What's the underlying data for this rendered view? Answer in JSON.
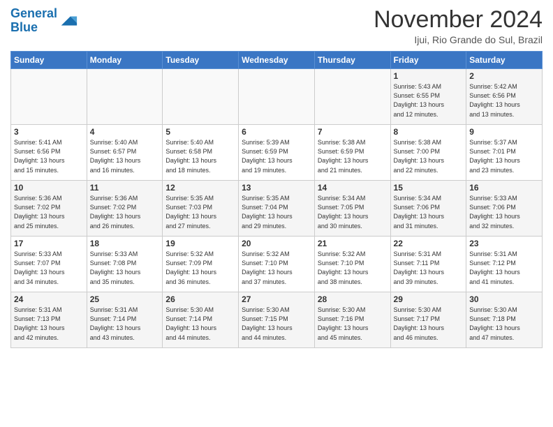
{
  "header": {
    "logo_line1": "General",
    "logo_line2": "Blue",
    "month_year": "November 2024",
    "location": "Ijui, Rio Grande do Sul, Brazil"
  },
  "weekdays": [
    "Sunday",
    "Monday",
    "Tuesday",
    "Wednesday",
    "Thursday",
    "Friday",
    "Saturday"
  ],
  "weeks": [
    [
      {
        "day": "",
        "info": ""
      },
      {
        "day": "",
        "info": ""
      },
      {
        "day": "",
        "info": ""
      },
      {
        "day": "",
        "info": ""
      },
      {
        "day": "",
        "info": ""
      },
      {
        "day": "1",
        "info": "Sunrise: 5:43 AM\nSunset: 6:55 PM\nDaylight: 13 hours\nand 12 minutes."
      },
      {
        "day": "2",
        "info": "Sunrise: 5:42 AM\nSunset: 6:56 PM\nDaylight: 13 hours\nand 13 minutes."
      }
    ],
    [
      {
        "day": "3",
        "info": "Sunrise: 5:41 AM\nSunset: 6:56 PM\nDaylight: 13 hours\nand 15 minutes."
      },
      {
        "day": "4",
        "info": "Sunrise: 5:40 AM\nSunset: 6:57 PM\nDaylight: 13 hours\nand 16 minutes."
      },
      {
        "day": "5",
        "info": "Sunrise: 5:40 AM\nSunset: 6:58 PM\nDaylight: 13 hours\nand 18 minutes."
      },
      {
        "day": "6",
        "info": "Sunrise: 5:39 AM\nSunset: 6:59 PM\nDaylight: 13 hours\nand 19 minutes."
      },
      {
        "day": "7",
        "info": "Sunrise: 5:38 AM\nSunset: 6:59 PM\nDaylight: 13 hours\nand 21 minutes."
      },
      {
        "day": "8",
        "info": "Sunrise: 5:38 AM\nSunset: 7:00 PM\nDaylight: 13 hours\nand 22 minutes."
      },
      {
        "day": "9",
        "info": "Sunrise: 5:37 AM\nSunset: 7:01 PM\nDaylight: 13 hours\nand 23 minutes."
      }
    ],
    [
      {
        "day": "10",
        "info": "Sunrise: 5:36 AM\nSunset: 7:02 PM\nDaylight: 13 hours\nand 25 minutes."
      },
      {
        "day": "11",
        "info": "Sunrise: 5:36 AM\nSunset: 7:02 PM\nDaylight: 13 hours\nand 26 minutes."
      },
      {
        "day": "12",
        "info": "Sunrise: 5:35 AM\nSunset: 7:03 PM\nDaylight: 13 hours\nand 27 minutes."
      },
      {
        "day": "13",
        "info": "Sunrise: 5:35 AM\nSunset: 7:04 PM\nDaylight: 13 hours\nand 29 minutes."
      },
      {
        "day": "14",
        "info": "Sunrise: 5:34 AM\nSunset: 7:05 PM\nDaylight: 13 hours\nand 30 minutes."
      },
      {
        "day": "15",
        "info": "Sunrise: 5:34 AM\nSunset: 7:06 PM\nDaylight: 13 hours\nand 31 minutes."
      },
      {
        "day": "16",
        "info": "Sunrise: 5:33 AM\nSunset: 7:06 PM\nDaylight: 13 hours\nand 32 minutes."
      }
    ],
    [
      {
        "day": "17",
        "info": "Sunrise: 5:33 AM\nSunset: 7:07 PM\nDaylight: 13 hours\nand 34 minutes."
      },
      {
        "day": "18",
        "info": "Sunrise: 5:33 AM\nSunset: 7:08 PM\nDaylight: 13 hours\nand 35 minutes."
      },
      {
        "day": "19",
        "info": "Sunrise: 5:32 AM\nSunset: 7:09 PM\nDaylight: 13 hours\nand 36 minutes."
      },
      {
        "day": "20",
        "info": "Sunrise: 5:32 AM\nSunset: 7:10 PM\nDaylight: 13 hours\nand 37 minutes."
      },
      {
        "day": "21",
        "info": "Sunrise: 5:32 AM\nSunset: 7:10 PM\nDaylight: 13 hours\nand 38 minutes."
      },
      {
        "day": "22",
        "info": "Sunrise: 5:31 AM\nSunset: 7:11 PM\nDaylight: 13 hours\nand 39 minutes."
      },
      {
        "day": "23",
        "info": "Sunrise: 5:31 AM\nSunset: 7:12 PM\nDaylight: 13 hours\nand 41 minutes."
      }
    ],
    [
      {
        "day": "24",
        "info": "Sunrise: 5:31 AM\nSunset: 7:13 PM\nDaylight: 13 hours\nand 42 minutes."
      },
      {
        "day": "25",
        "info": "Sunrise: 5:31 AM\nSunset: 7:14 PM\nDaylight: 13 hours\nand 43 minutes."
      },
      {
        "day": "26",
        "info": "Sunrise: 5:30 AM\nSunset: 7:14 PM\nDaylight: 13 hours\nand 44 minutes."
      },
      {
        "day": "27",
        "info": "Sunrise: 5:30 AM\nSunset: 7:15 PM\nDaylight: 13 hours\nand 44 minutes."
      },
      {
        "day": "28",
        "info": "Sunrise: 5:30 AM\nSunset: 7:16 PM\nDaylight: 13 hours\nand 45 minutes."
      },
      {
        "day": "29",
        "info": "Sunrise: 5:30 AM\nSunset: 7:17 PM\nDaylight: 13 hours\nand 46 minutes."
      },
      {
        "day": "30",
        "info": "Sunrise: 5:30 AM\nSunset: 7:18 PM\nDaylight: 13 hours\nand 47 minutes."
      }
    ]
  ]
}
